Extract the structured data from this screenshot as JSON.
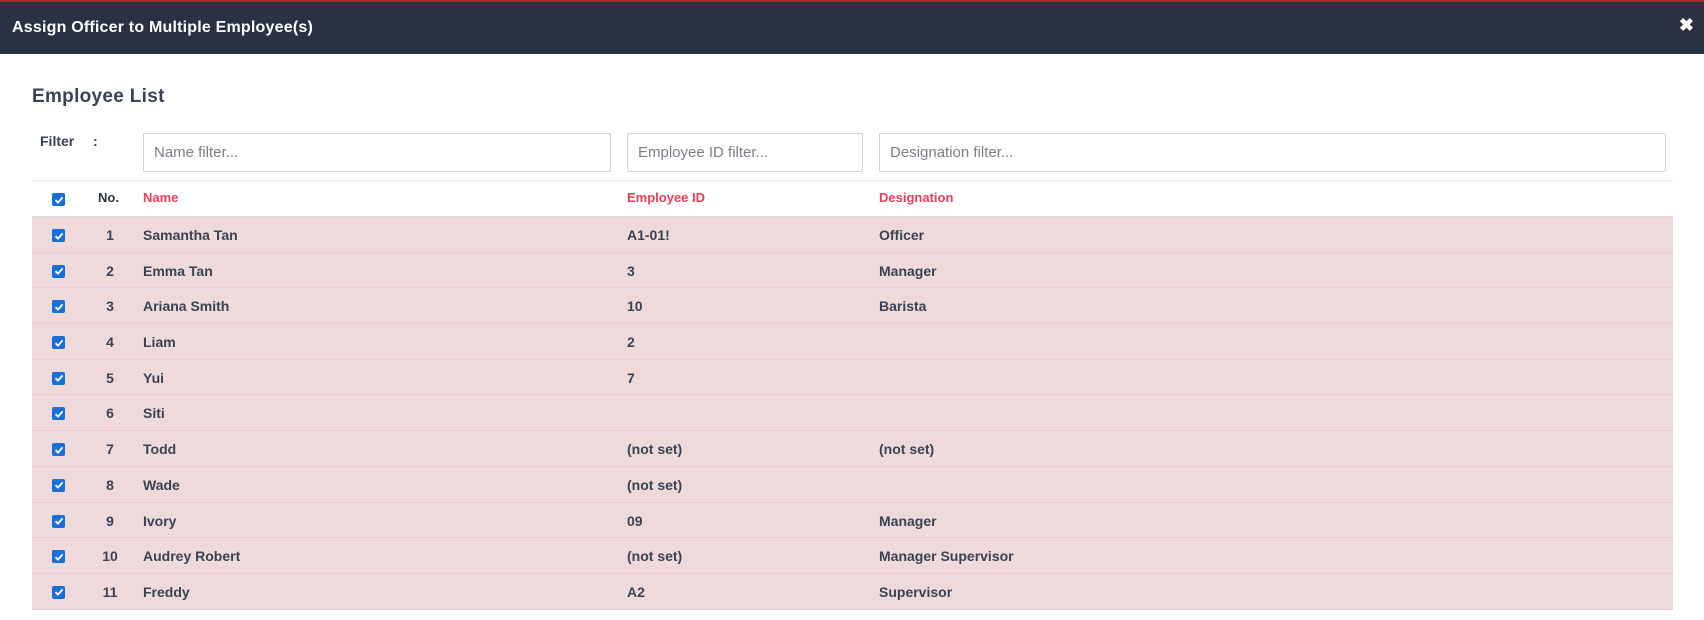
{
  "modal": {
    "title": "Assign Officer to Multiple Employee(s)",
    "close_symbol": "✖"
  },
  "section_title": "Employee List",
  "filter": {
    "label": "Filter",
    "colon": ":",
    "name_placeholder": "Name filter...",
    "id_placeholder": "Employee ID filter...",
    "designation_placeholder": "Designation filter..."
  },
  "table": {
    "headers": {
      "no": "No.",
      "name": "Name",
      "employee_id": "Employee ID",
      "designation": "Designation"
    },
    "rows": [
      {
        "no": "1",
        "name": "Samantha Tan",
        "employee_id": "A1-01!",
        "designation": "Officer",
        "checked": true
      },
      {
        "no": "2",
        "name": "Emma Tan",
        "employee_id": "3",
        "designation": "Manager",
        "checked": true
      },
      {
        "no": "3",
        "name": "Ariana Smith",
        "employee_id": "10",
        "designation": "Barista",
        "checked": true
      },
      {
        "no": "4",
        "name": "Liam",
        "employee_id": "2",
        "designation": "",
        "checked": true
      },
      {
        "no": "5",
        "name": "Yui",
        "employee_id": "7",
        "designation": "",
        "checked": true
      },
      {
        "no": "6",
        "name": "Siti",
        "employee_id": "",
        "designation": "",
        "checked": true
      },
      {
        "no": "7",
        "name": "Todd",
        "employee_id": "(not set)",
        "designation": "(not set)",
        "checked": true
      },
      {
        "no": "8",
        "name": "Wade",
        "employee_id": "(not set)",
        "designation": "",
        "checked": true
      },
      {
        "no": "9",
        "name": "Ivory",
        "employee_id": "09",
        "designation": "Manager",
        "checked": true
      },
      {
        "no": "10",
        "name": "Audrey Robert",
        "employee_id": "(not set)",
        "designation": "Manager Supervisor",
        "checked": true
      },
      {
        "no": "11",
        "name": "Freddy",
        "employee_id": "A2",
        "designation": "Supervisor",
        "checked": true
      }
    ]
  },
  "colors": {
    "header_bg": "#2a3142",
    "row_bg": "#eedada",
    "sort_header": "#e8405a",
    "checkbox": "#1a6fd6"
  }
}
